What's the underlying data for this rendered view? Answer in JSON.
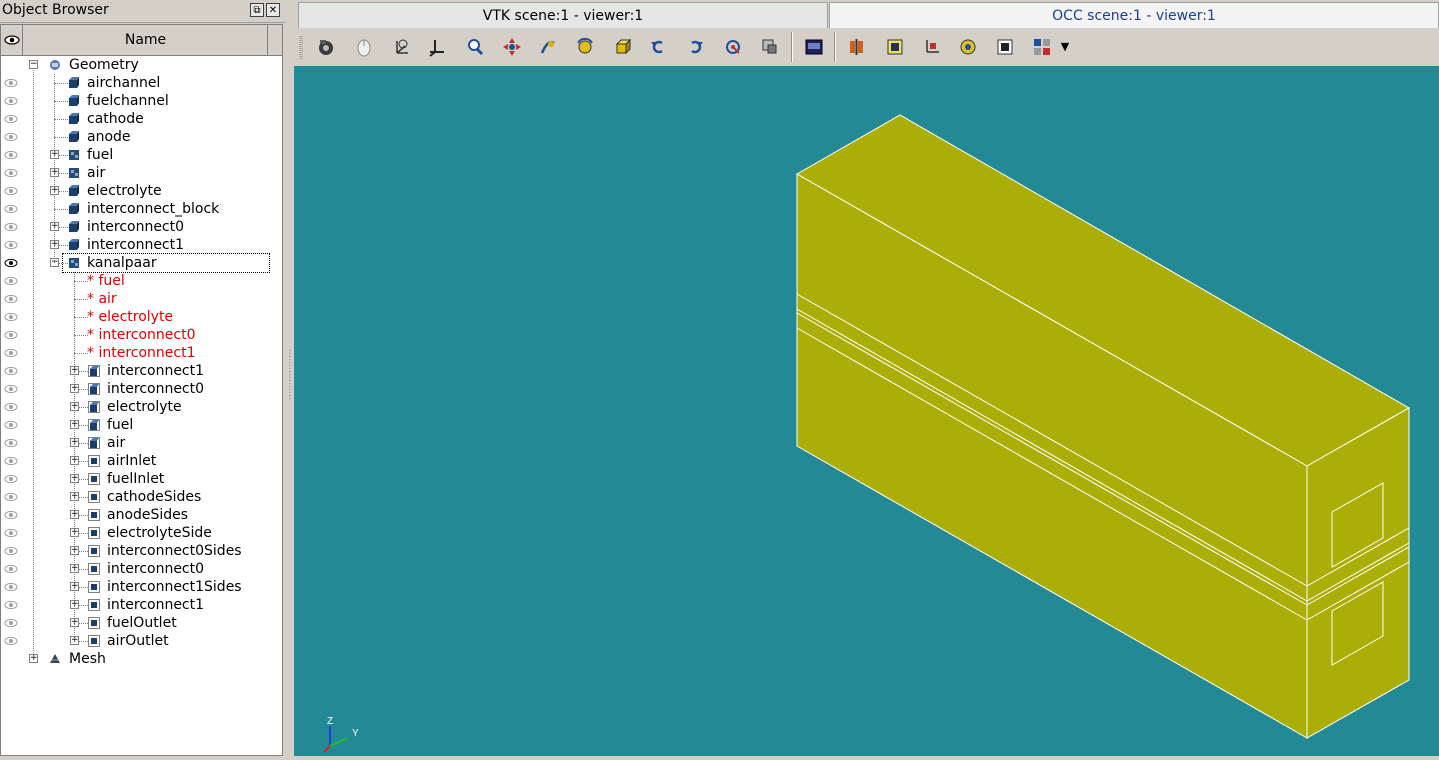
{
  "object_browser": {
    "title": "Object Browser",
    "header_name": "Name",
    "tree": [
      {
        "label": "Geometry",
        "level": 0,
        "expander": "-",
        "icon": "geometry-icon",
        "eye": false,
        "red": false
      },
      {
        "label": "airchannel",
        "level": 1,
        "expander": "",
        "icon": "solid-icon",
        "eye": true,
        "red": false
      },
      {
        "label": "fuelchannel",
        "level": 1,
        "expander": "",
        "icon": "solid-icon",
        "eye": true,
        "red": false
      },
      {
        "label": "cathode",
        "level": 1,
        "expander": "",
        "icon": "solid-icon",
        "eye": true,
        "red": false
      },
      {
        "label": "anode",
        "level": 1,
        "expander": "",
        "icon": "solid-icon",
        "eye": true,
        "red": false
      },
      {
        "label": "fuel",
        "level": 1,
        "expander": "+",
        "icon": "compound-icon",
        "eye": true,
        "red": false
      },
      {
        "label": "air",
        "level": 1,
        "expander": "+",
        "icon": "compound-icon",
        "eye": true,
        "red": false
      },
      {
        "label": "electrolyte",
        "level": 1,
        "expander": "+",
        "icon": "solid-icon",
        "eye": true,
        "red": false
      },
      {
        "label": "interconnect_block",
        "level": 1,
        "expander": "",
        "icon": "solid-icon",
        "eye": true,
        "red": false
      },
      {
        "label": "interconnect0",
        "level": 1,
        "expander": "+",
        "icon": "solid-icon",
        "eye": true,
        "red": false
      },
      {
        "label": "interconnect1",
        "level": 1,
        "expander": "+",
        "icon": "solid-icon",
        "eye": true,
        "red": false
      },
      {
        "label": "kanalpaar",
        "level": 1,
        "expander": "-",
        "icon": "compound-icon",
        "eye": true,
        "red": false,
        "selected": true,
        "eye_active": true
      },
      {
        "label": "* fuel",
        "level": 2,
        "expander": "",
        "icon": "",
        "eye": true,
        "red": true
      },
      {
        "label": "* air",
        "level": 2,
        "expander": "",
        "icon": "",
        "eye": true,
        "red": true
      },
      {
        "label": "* electrolyte",
        "level": 2,
        "expander": "",
        "icon": "",
        "eye": true,
        "red": true
      },
      {
        "label": "* interconnect0",
        "level": 2,
        "expander": "",
        "icon": "",
        "eye": true,
        "red": true
      },
      {
        "label": "* interconnect1",
        "level": 2,
        "expander": "",
        "icon": "",
        "eye": true,
        "red": true
      },
      {
        "label": "interconnect1",
        "level": 2,
        "expander": "+",
        "icon": "group-icon",
        "eye": true,
        "red": false
      },
      {
        "label": "interconnect0",
        "level": 2,
        "expander": "+",
        "icon": "group-icon",
        "eye": true,
        "red": false
      },
      {
        "label": "electrolyte",
        "level": 2,
        "expander": "+",
        "icon": "group-icon",
        "eye": true,
        "red": false
      },
      {
        "label": "fuel",
        "level": 2,
        "expander": "+",
        "icon": "group-icon",
        "eye": true,
        "red": false
      },
      {
        "label": "air",
        "level": 2,
        "expander": "+",
        "icon": "group-icon",
        "eye": true,
        "red": false
      },
      {
        "label": "airInlet",
        "level": 2,
        "expander": "+",
        "icon": "face-group-icon",
        "eye": true,
        "red": false
      },
      {
        "label": "fuelInlet",
        "level": 2,
        "expander": "+",
        "icon": "face-group-icon",
        "eye": true,
        "red": false
      },
      {
        "label": "cathodeSides",
        "level": 2,
        "expander": "+",
        "icon": "face-group-icon",
        "eye": true,
        "red": false
      },
      {
        "label": "anodeSides",
        "level": 2,
        "expander": "+",
        "icon": "face-group-icon",
        "eye": true,
        "red": false
      },
      {
        "label": "electrolyteSide",
        "level": 2,
        "expander": "+",
        "icon": "face-group-icon",
        "eye": true,
        "red": false
      },
      {
        "label": "interconnect0Sides",
        "level": 2,
        "expander": "+",
        "icon": "face-group-icon",
        "eye": true,
        "red": false
      },
      {
        "label": "interconnect0",
        "level": 2,
        "expander": "+",
        "icon": "face-group-icon",
        "eye": true,
        "red": false
      },
      {
        "label": "interconnect1Sides",
        "level": 2,
        "expander": "+",
        "icon": "face-group-icon",
        "eye": true,
        "red": false
      },
      {
        "label": "interconnect1",
        "level": 2,
        "expander": "+",
        "icon": "face-group-icon",
        "eye": true,
        "red": false
      },
      {
        "label": "fuelOutlet",
        "level": 2,
        "expander": "+",
        "icon": "face-group-icon",
        "eye": true,
        "red": false
      },
      {
        "label": "airOutlet",
        "level": 2,
        "expander": "+",
        "icon": "face-group-icon",
        "eye": true,
        "red": false
      },
      {
        "label": "Mesh",
        "level": 0,
        "expander": "+",
        "icon": "mesh-icon",
        "eye": false,
        "red": false
      }
    ]
  },
  "tabs": [
    {
      "label": "VTK scene:1 - viewer:1",
      "active": false
    },
    {
      "label": "OCC scene:1 - viewer:1",
      "active": true
    }
  ],
  "toolbar": {
    "icons": [
      "dump-view-icon",
      "interaction-style-icon",
      "trihedron-icon",
      "fit-all-icon",
      "zoom-icon",
      "pan-icon",
      "global-pan-icon",
      "rotate-icon",
      "shading-icon",
      "anticlockwise-icon",
      "clockwise-icon",
      "reset-view-icon",
      "clipping-icon",
      "graduated-axes-icon",
      "front-view-icon",
      "back-view-icon",
      "top-view-icon",
      "bottom-view-icon",
      "scaling-icon",
      "more-icon"
    ]
  },
  "viewer": {
    "background": "#238a95",
    "shape_color": "#abae06",
    "edge_color": "#ffffff",
    "axis_labels": {
      "z": "Z",
      "y": "Y"
    }
  }
}
